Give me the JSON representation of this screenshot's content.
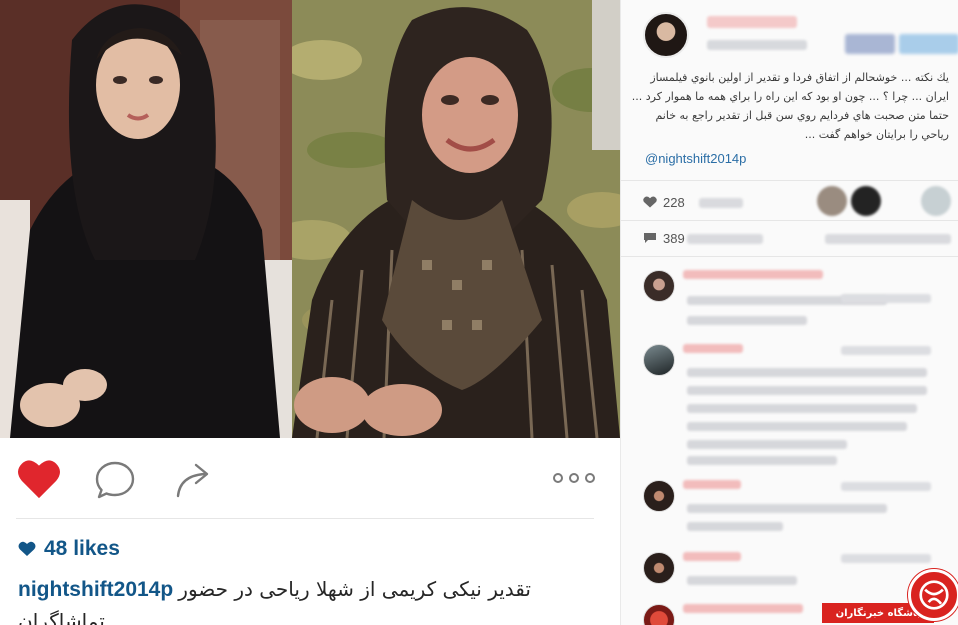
{
  "post": {
    "likes_label": "48 likes",
    "caption_username": "nightshift2014p",
    "caption_text_line1": "تقدیر نیکی کریمی از شهلا ریاحی در حضور",
    "caption_text_line2": "تماشاگران"
  },
  "side": {
    "description": "يك نكته ... خوشحالم از اتفاق فردا و تقدير از اولين بانوي فيلمساز ايران ... چرا ؟ ... چون او بود كه اين راه را براي همه ما هموار كرد ... حتما متن صحبت هاي فردايم روي سن قبل از تقدير راجع به خانم رياحي را برايتان خواهم گفت ...",
    "mention": "@nightshift2014p",
    "likes_count": "228",
    "comments_count": "389"
  },
  "watermark": {
    "label": "باشگاه خبرنگاران"
  },
  "colors": {
    "like_red": "#ed4956",
    "link_blue": "#125688",
    "watermark_red": "#d9231f"
  },
  "icons": [
    "heart-filled-icon",
    "comment-icon",
    "share-icon",
    "more-icon",
    "small-heart-icon",
    "speech-bubble-icon"
  ]
}
